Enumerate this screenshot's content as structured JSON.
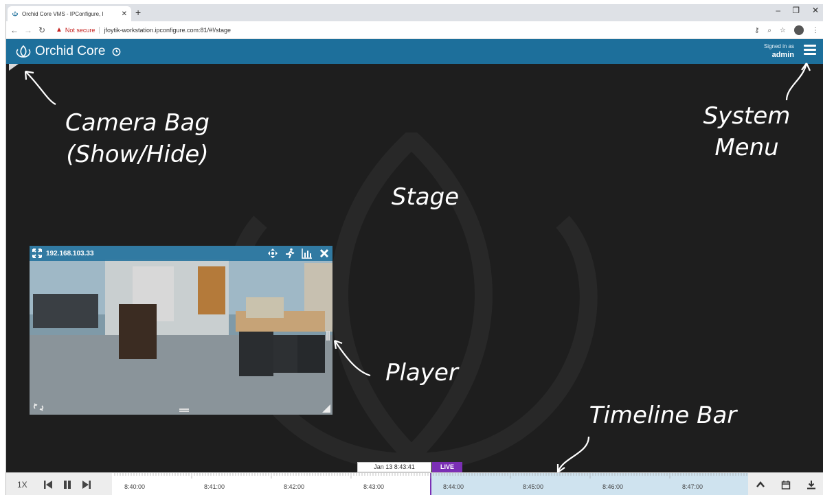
{
  "browser": {
    "tab_title": "Orchid Core VMS - IPConfigure, I",
    "tab_close": "✕",
    "new_tab": "+",
    "not_secure": "Not secure",
    "url": "jfoytik-workstation.ipconfigure.com:81/#!/stage",
    "minimize": "–",
    "restore": "❐",
    "close": "✕"
  },
  "app": {
    "brand": "Orchid Core",
    "signed_in_label": "Signed in as",
    "username": "admin"
  },
  "callouts": {
    "camera_bag_1": "Camera Bag",
    "camera_bag_2": "(Show/Hide)",
    "system_menu_1": "System",
    "system_menu_2": "Menu",
    "stage": "Stage",
    "player": "Player",
    "timeline_bar": "Timeline Bar"
  },
  "player": {
    "camera_ip": "192.168.103.33"
  },
  "timeline": {
    "speed": "1X",
    "current_time": "Jan 13 8:43:41",
    "live_label": "LIVE",
    "tick_labels": [
      "8:40:00",
      "8:41:00",
      "8:42:00",
      "8:43:00",
      "8:44:00",
      "8:45:00",
      "8:46:00",
      "8:47:00"
    ]
  },
  "colors": {
    "header_blue": "#1d6f9b",
    "stage_bg": "#1e1e1e",
    "live_purple": "#7b2fb5",
    "future_blue": "#cfe3ef"
  }
}
